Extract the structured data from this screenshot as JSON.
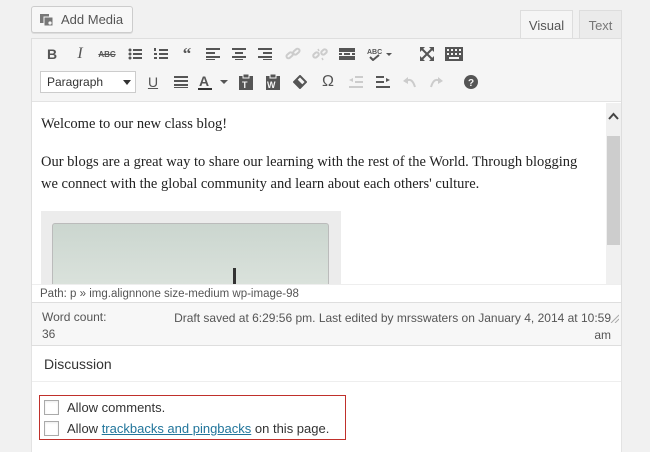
{
  "media": {
    "add_media_label": "Add Media"
  },
  "tabs": [
    {
      "label": "Visual"
    },
    {
      "label": "Text"
    }
  ],
  "toolbar": {
    "row1": [
      "bold",
      "italic",
      "strikethrough",
      "bullet-list",
      "numbered-list",
      "blockquote",
      "align-left",
      "align-center",
      "align-right",
      "insert-link",
      "remove-link",
      "read-more",
      "spellcheck",
      "fullscreen",
      "toolbar-toggle"
    ],
    "format_select": "Paragraph",
    "row2": [
      "underline",
      "justify",
      "text-color",
      "paste-text",
      "paste-word",
      "clear-formatting",
      "special-character",
      "outdent",
      "indent",
      "undo",
      "redo",
      "help"
    ]
  },
  "content": {
    "paragraphs": [
      "Welcome to our new class blog!",
      "Our blogs are a great way to share our learning with the rest of the World. Through blogging we connect with the global community and learn about each others' culture."
    ]
  },
  "path": "Path: p » img.alignnone size-medium wp-image-98",
  "status": {
    "word_count_label": "Word count:",
    "word_count": "36",
    "saved_line1": "Draft saved at 6:29:56 pm. Last edited by mrsswaters on January 4, 2014 at 10:59",
    "saved_line2": "am"
  },
  "discussion": {
    "title": "Discussion",
    "allow_comments": "Allow comments.",
    "allow_prefix": "Allow ",
    "trackbacks_link": "trackbacks and pingbacks",
    "allow_suffix": " on this page."
  },
  "colors": {
    "link": "#21759b",
    "highlight_border": "#c0302b"
  }
}
